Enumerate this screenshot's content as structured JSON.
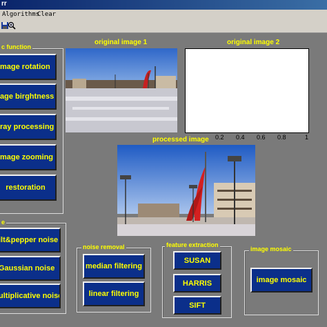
{
  "window": {
    "title": "rr"
  },
  "menu": {
    "items": [
      "Algorithms",
      "Clear"
    ]
  },
  "toolbar": {
    "icons": [
      "save-icon",
      "zoom-in-icon"
    ]
  },
  "basic_function": {
    "label": "c function",
    "buttons": [
      "mage rotation",
      "age birghtness",
      "ray processing",
      "mage zooming",
      "restoration"
    ]
  },
  "noise_panel": {
    "label": "e",
    "buttons": [
      "ilt&pepper noise",
      "Gaussian noise",
      "ultiplicative noise"
    ]
  },
  "noise_removal": {
    "label": "noise removal",
    "buttons": [
      "median filtering",
      "linear filtering"
    ]
  },
  "feature_extraction": {
    "label": "feature extraction",
    "buttons": [
      "SUSAN",
      "HARRIS",
      "SIFT"
    ]
  },
  "image_mosaic": {
    "label": "image mosaic",
    "button": "image mosaic"
  },
  "images": {
    "original1_title": "original image 1",
    "original2_title": "original image 2",
    "processed_title": "processed image"
  },
  "axes2": {
    "x_ticks": [
      "0.2",
      "0.4",
      "0.6",
      "0.8",
      "1"
    ]
  },
  "colors": {
    "button_bg": "#0b2f8a",
    "button_text": "#ffff00",
    "label_text": "#ffff00",
    "background": "#7a7a7a"
  }
}
